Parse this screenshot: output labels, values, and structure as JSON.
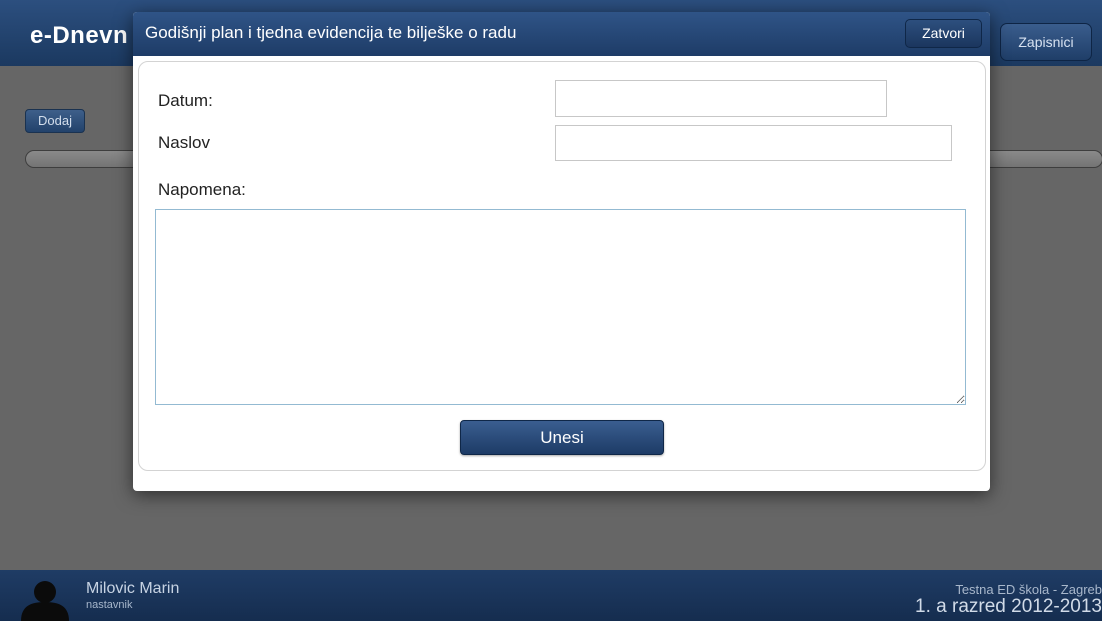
{
  "app": {
    "logo": "e-Dnevn",
    "top_button": "Zapisnici",
    "add_button": "Dodaj"
  },
  "footer": {
    "user_name": "Milovic Marin",
    "user_role": "nastavnik",
    "school": "Testna ED škola - Zagreb",
    "class_label": "1. a razred 2012-2013"
  },
  "modal": {
    "title": "Godišnji plan i tjedna evidencija te bilješke o radu",
    "close_label": "Zatvori",
    "form": {
      "date_label": "Datum:",
      "date_value": "",
      "title_label": "Naslov",
      "title_value": "",
      "note_label": "Napomena:",
      "note_value": "",
      "submit_label": "Unesi"
    }
  },
  "icons": {
    "avatar": "user-silhouette-icon"
  },
  "colors": {
    "header_blue": "#1e3c67",
    "button_blue": "#2d4f7e",
    "overlay_gray": "#666666",
    "text_dark": "#222222"
  }
}
